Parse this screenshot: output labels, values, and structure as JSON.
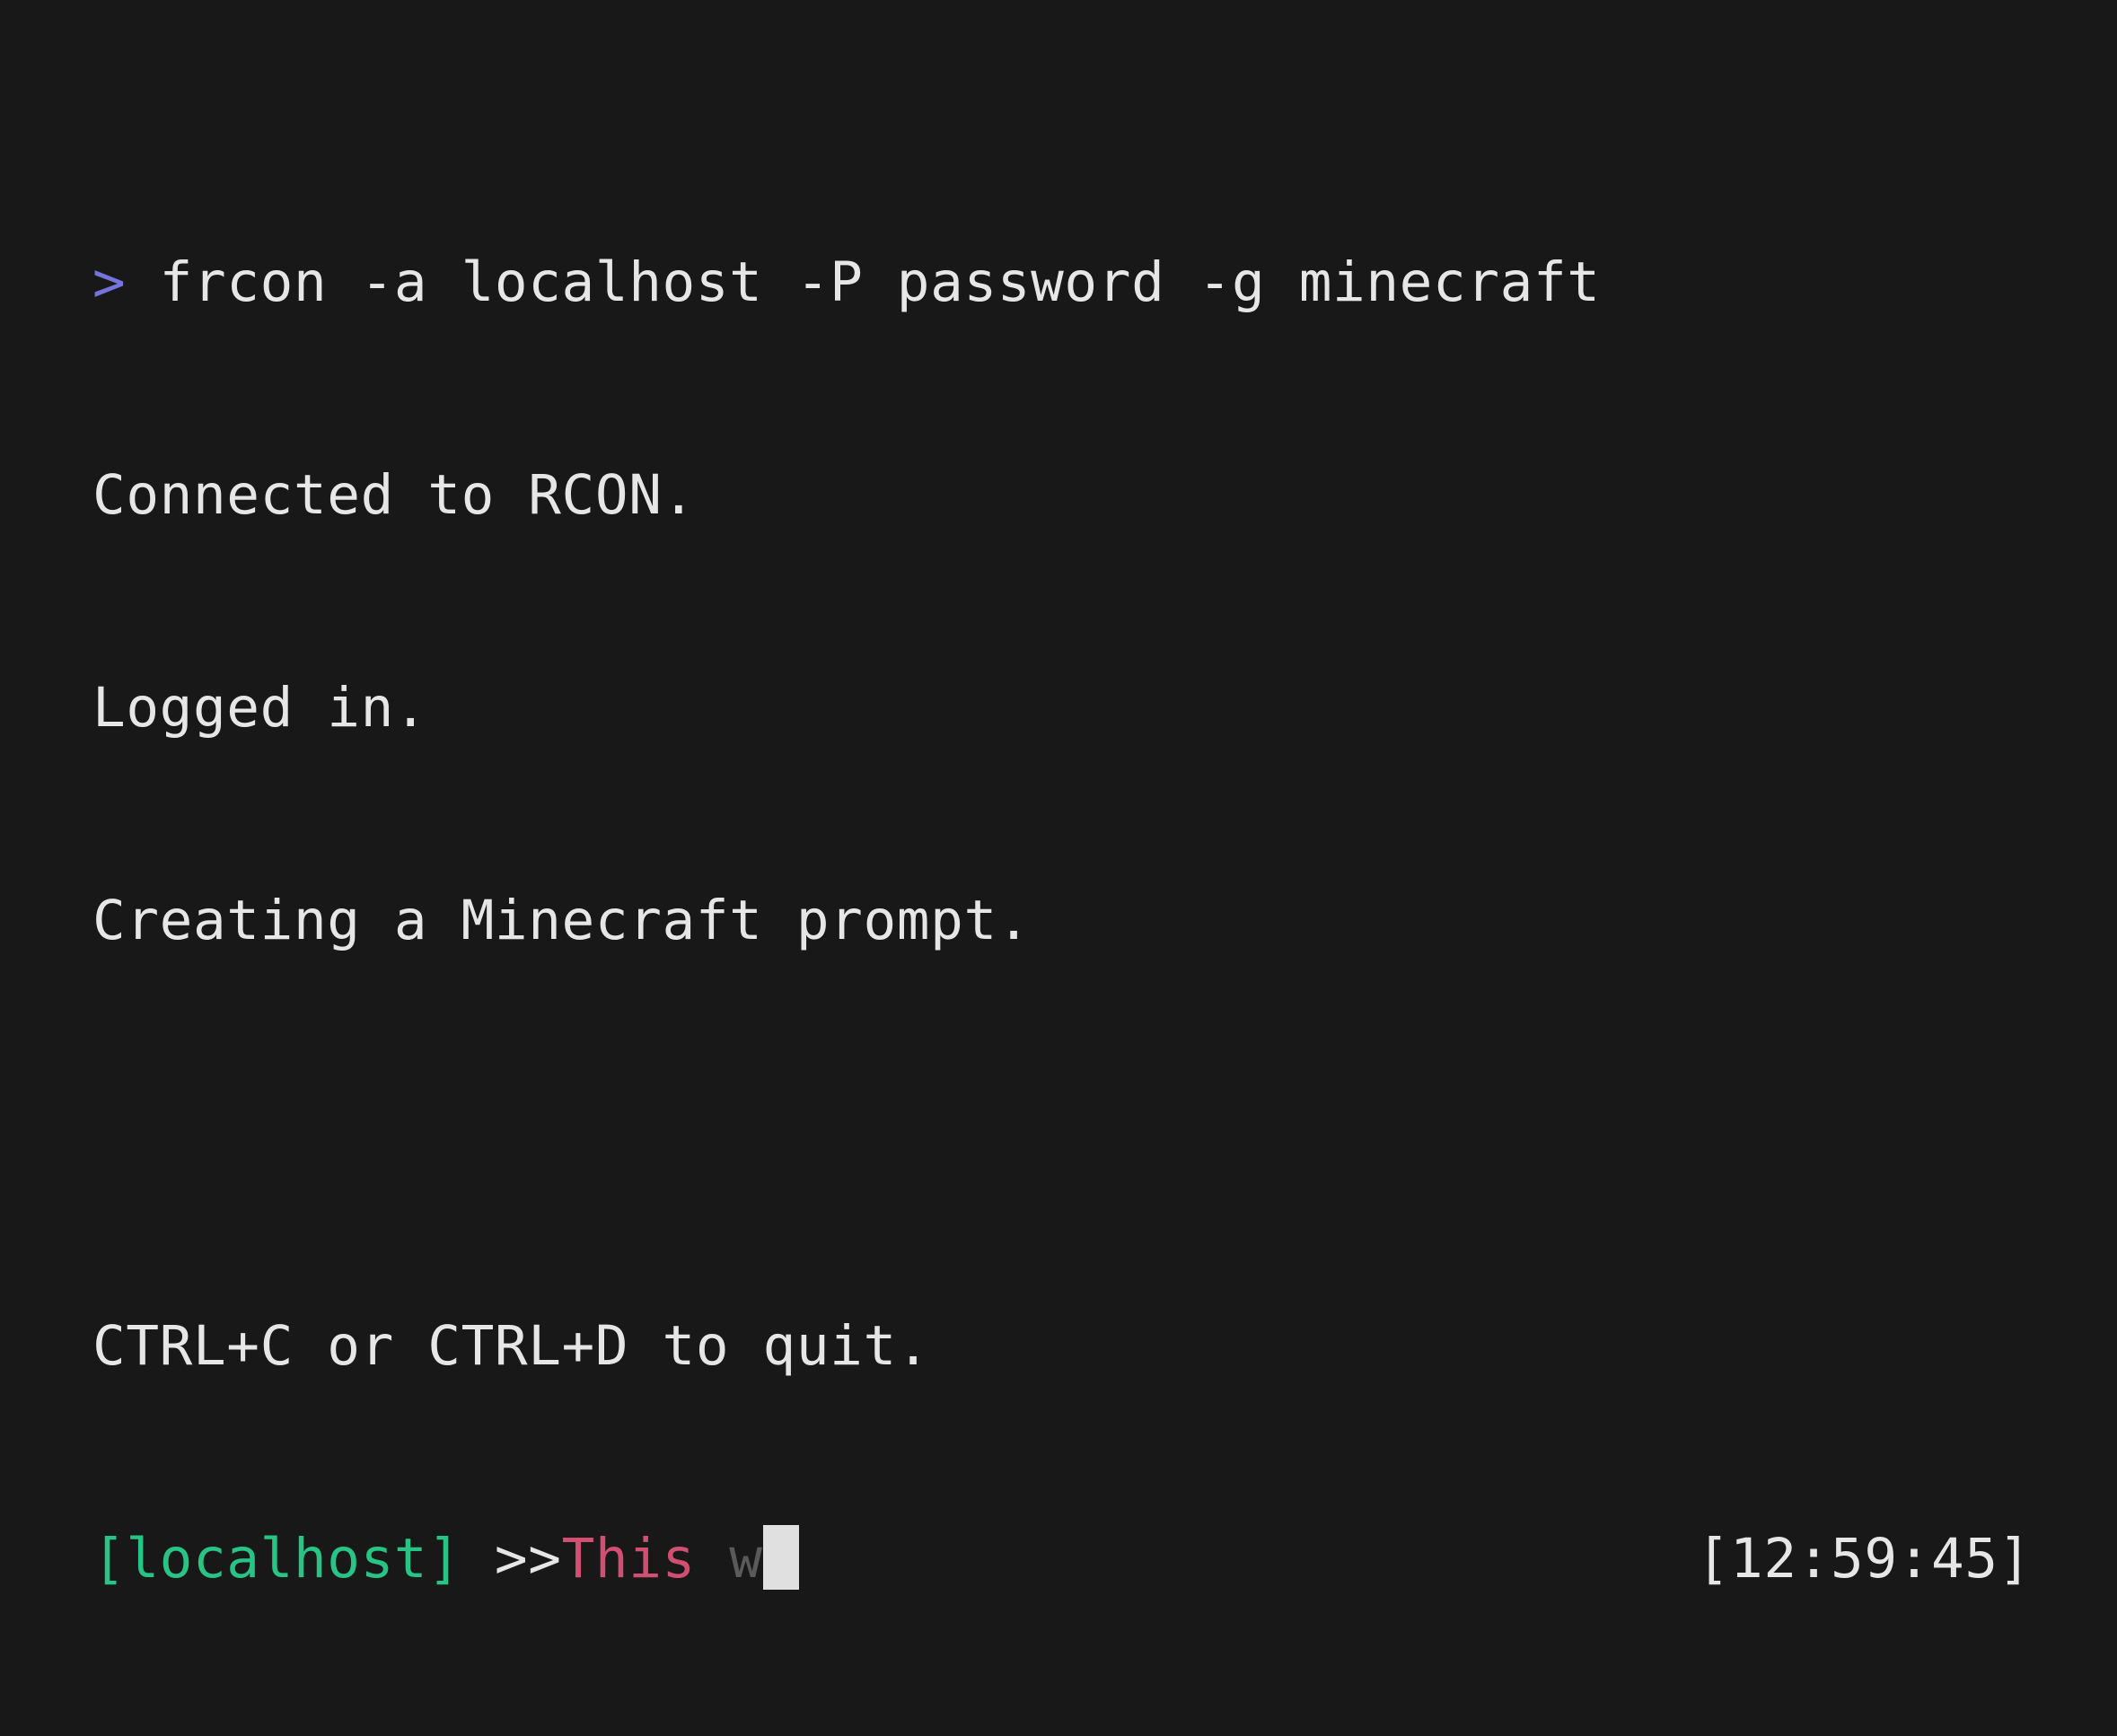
{
  "terminal": {
    "command_line": {
      "prompt": ">",
      "command": "frcon -a localhost -P password -g minecraft"
    },
    "output": [
      "Connected to RCON.",
      "Logged in.",
      "Creating a Minecraft prompt.",
      "",
      "CTRL+C or CTRL+D to quit."
    ],
    "repl": {
      "host_tag": "[localhost]",
      "separator": ">>",
      "typed_text": "This",
      "autosuggestion": "w",
      "clock": "[12:59:45]"
    }
  },
  "colors": {
    "background": "#181818",
    "text": "#e6e6e6",
    "prompt_arrow": "#7474dc",
    "host_tag": "#27c486",
    "typed_text": "#d24f74",
    "autosuggestion": "#5a5a5a",
    "cursor": "#e0e0e0"
  }
}
